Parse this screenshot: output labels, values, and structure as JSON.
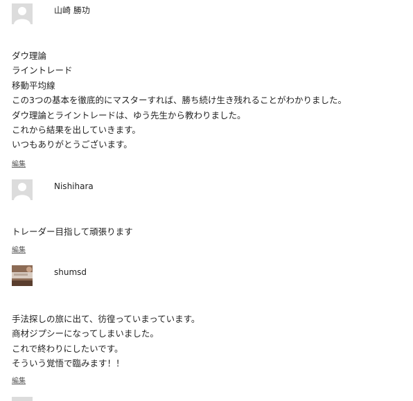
{
  "comments": [
    {
      "author": "山崎 勝功",
      "lines": [
        "ダウ理論",
        "ライントレード",
        "移動平均線",
        "この3つの基本を徹底的にマスターすれば、勝ち続け生き残れることがわかりました。",
        "ダウ理論とライントレードは、ゆう先生から教わりました。",
        "これから結果を出していきます。",
        "いつもありがとうございます。"
      ],
      "edit_label": "編集"
    },
    {
      "author": "Nishihara",
      "lines": [
        "トレーダー目指して頑張ります"
      ],
      "edit_label": "編集"
    },
    {
      "author": "shumsd",
      "lines": [
        "手法探しの旅に出て、彷徨っていまっています。",
        "商材ジプシーになってしまいました。",
        "これで終わりにしたいです。",
        "そういう覚悟で臨みます！！"
      ],
      "edit_label": "編集"
    }
  ]
}
